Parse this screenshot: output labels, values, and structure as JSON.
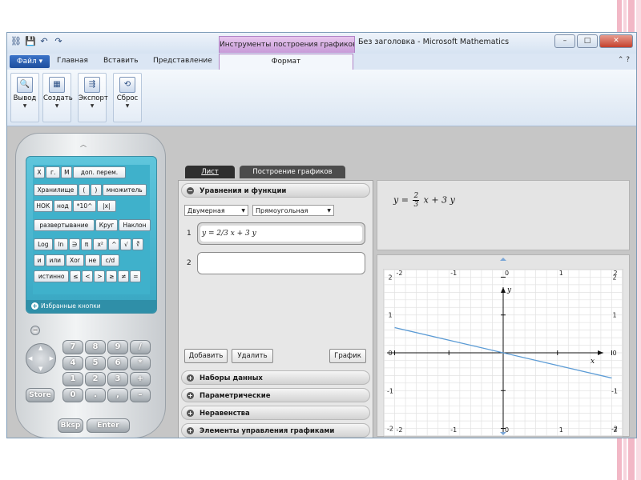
{
  "window": {
    "context_tab_title": "Инструменты построения графиков",
    "app_title": "Без заголовка - Microsoft Mathematics",
    "controls": [
      "–",
      "□",
      "✕"
    ]
  },
  "quick_access": {
    "icons": [
      "chain-icon",
      "save-icon",
      "undo-icon",
      "redo-icon"
    ]
  },
  "tabs": {
    "file": "Файл",
    "home": "Главная",
    "insert": "Вставить",
    "view": "Представление",
    "format": "Формат",
    "help": "⌃ ?"
  },
  "ribbon": {
    "groups": [
      {
        "label": "Вывод",
        "icon": "magnifier-icon",
        "glyph": "🔍"
      },
      {
        "label": "Создать",
        "icon": "table-icon",
        "glyph": "▦"
      },
      {
        "label": "Экспорт",
        "icon": "export-icon",
        "glyph": "⇶"
      },
      {
        "label": "Сброс",
        "icon": "reset-icon",
        "glyph": "⟲"
      }
    ]
  },
  "calculator": {
    "rows": [
      [
        "X",
        "г.",
        "M",
        "доп. перем."
      ],
      [
        "Хранилище",
        "(",
        ")",
        "множитель"
      ],
      [
        "НОК",
        "нод",
        "*10^",
        "|x|"
      ],
      [
        "развертывание",
        "Круг",
        "Наклон"
      ],
      [
        "Log",
        "ln",
        "∋",
        "π",
        "x²",
        "^",
        "√",
        "∛"
      ],
      [
        "и",
        "или",
        "Xor",
        "не",
        "c/d"
      ],
      [
        "истинно",
        "≤",
        "<",
        ">",
        "≥",
        "≠",
        "="
      ]
    ],
    "favorites": "Избранные кнопки",
    "keypad": [
      [
        "7",
        "8",
        "9",
        "/"
      ],
      [
        "4",
        "5",
        "6",
        "*"
      ],
      [
        "1",
        "2",
        "3",
        "+"
      ],
      [
        "0",
        ".",
        ",",
        "–"
      ]
    ],
    "store": "Store",
    "backspace": "Bksp",
    "enter": "Enter"
  },
  "workspace_tabs": {
    "sheet": "Лист",
    "graphing": "Построение графиков"
  },
  "pane": {
    "equations_header": "Уравнения и функции",
    "dimension": "Двумерная",
    "coordinates": "Прямоугольная",
    "equations": [
      {
        "num": "1",
        "text": "y = 2/3 x + 3 y"
      },
      {
        "num": "2",
        "text": ""
      }
    ],
    "add_button": "Добавить",
    "delete_button": "Удалить",
    "graph_button": "График",
    "sections": [
      "Наборы данных",
      "Параметрические",
      "Неравенства",
      "Элементы управления графиками"
    ]
  },
  "formula": {
    "y": "y",
    "num": "2",
    "den": "3",
    "rest": "x + 3 y"
  },
  "chart_data": {
    "type": "line",
    "title": "",
    "xlabel": "x",
    "ylabel": "y",
    "xlim": [
      -2.2,
      2.2
    ],
    "ylim": [
      -2.2,
      2.2
    ],
    "grid": true,
    "x_ticks": [
      "-2",
      "-1",
      "0",
      "1",
      "2"
    ],
    "y_ticks": [
      "2",
      "1",
      "0",
      "-1",
      "-2"
    ],
    "series": [
      {
        "equation": "y = 2/3 x + 3 y",
        "color": "#5b9bd5",
        "x": [
          -2.0,
          2.0
        ],
        "y": [
          0.667,
          -0.667
        ]
      }
    ]
  }
}
